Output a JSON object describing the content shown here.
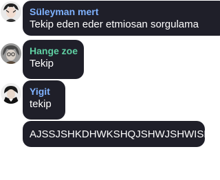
{
  "colors": {
    "bubble_bg": "#1f1f29",
    "message_text": "#ffffff",
    "page_bg": "#ffffff"
  },
  "messages": [
    {
      "sender": "Süleyman mert",
      "sender_color": "#7fb2ff",
      "text": "Tekip eden eder etmiosan sorgulama",
      "avatar_icon": "user-avatar-icon"
    },
    {
      "sender": "Hange zoe",
      "sender_color": "#5fd0a3",
      "text": "Tekip",
      "avatar_icon": "user-avatar-icon"
    },
    {
      "sender": "Yigit",
      "sender_color": "#7fb2ff",
      "text": "tekip",
      "avatar_icon": "user-avatar-icon"
    },
    {
      "sender": "",
      "text": "AJSSJSHKDHWKSHQJSHWJSHWISH"
    }
  ]
}
